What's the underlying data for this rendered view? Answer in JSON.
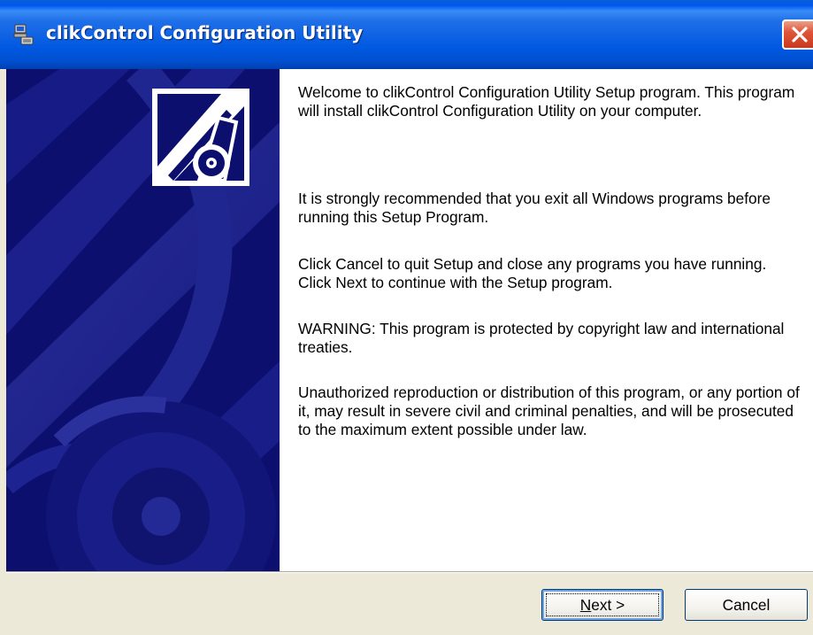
{
  "window": {
    "title": "clikControl Configuration Utility",
    "app_icon": "setup-computer-icon",
    "close_icon": "close-icon"
  },
  "content": {
    "paragraphs": [
      "Welcome to clikControl Configuration Utility Setup program. This program will install clikControl Configuration Utility on your computer.",
      "It is strongly recommended that you exit all Windows programs before running this Setup Program.",
      "Click Cancel to quit Setup and close any programs you have running.  Click Next to continue with the Setup program.",
      "WARNING: This program is protected by copyright law and international treaties.",
      "Unauthorized reproduction or distribution of this program, or any portion of it, may result in severe civil and criminal penalties, and will be prosecuted to the maximum extent possible under law."
    ]
  },
  "buttons": {
    "next_mnemonic": "N",
    "next_rest": "ext >",
    "cancel": "Cancel"
  },
  "colors": {
    "titlebar": "#0058ee",
    "side_art_background": "#0c0f6e",
    "dialog_face": "#ece9d8",
    "close_button": "#e0553a"
  }
}
